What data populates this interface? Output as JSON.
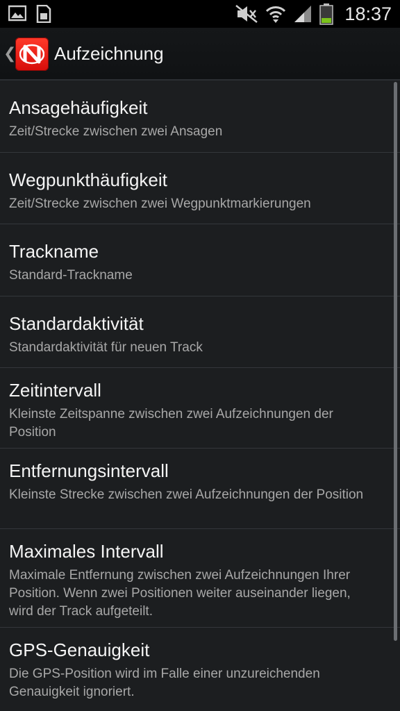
{
  "status_bar": {
    "time": "18:37",
    "icons": [
      "gallery-icon",
      "sim-card-icon",
      "mute-icon",
      "wifi-icon",
      "signal-icon",
      "battery-icon"
    ]
  },
  "action_bar": {
    "title": "Aufzeichnung",
    "logo_color": "#e8190f"
  },
  "settings": [
    {
      "title": "Ansagehäufigkeit",
      "summary": "Zeit/Strecke zwischen zwei Ansagen"
    },
    {
      "title": "Wegpunkthäufigkeit",
      "summary": "Zeit/Strecke zwischen zwei Wegpunktmarkierungen"
    },
    {
      "title": "Trackname",
      "summary": "Standard-Trackname"
    },
    {
      "title": "Standardaktivität",
      "summary": "Standardaktivität für neuen Track"
    },
    {
      "title": "Zeitintervall",
      "summary": "Kleinste Zeitspanne zwischen zwei Aufzeichnungen der Position"
    },
    {
      "title": "Entfernungsintervall",
      "summary": "Kleinste Strecke zwischen zwei Aufzeichnungen der Position"
    },
    {
      "title": "Maximales Intervall",
      "summary": "Maximale Entfernung zwischen zwei Aufzeichnungen Ihrer Position. Wenn zwei Positionen weiter auseinander liegen, wird der Track aufgeteilt."
    },
    {
      "title": "GPS-Genauigkeit",
      "summary": "Die GPS-Position wird im Falle einer unzureichenden Genauigkeit ignoriert."
    }
  ]
}
